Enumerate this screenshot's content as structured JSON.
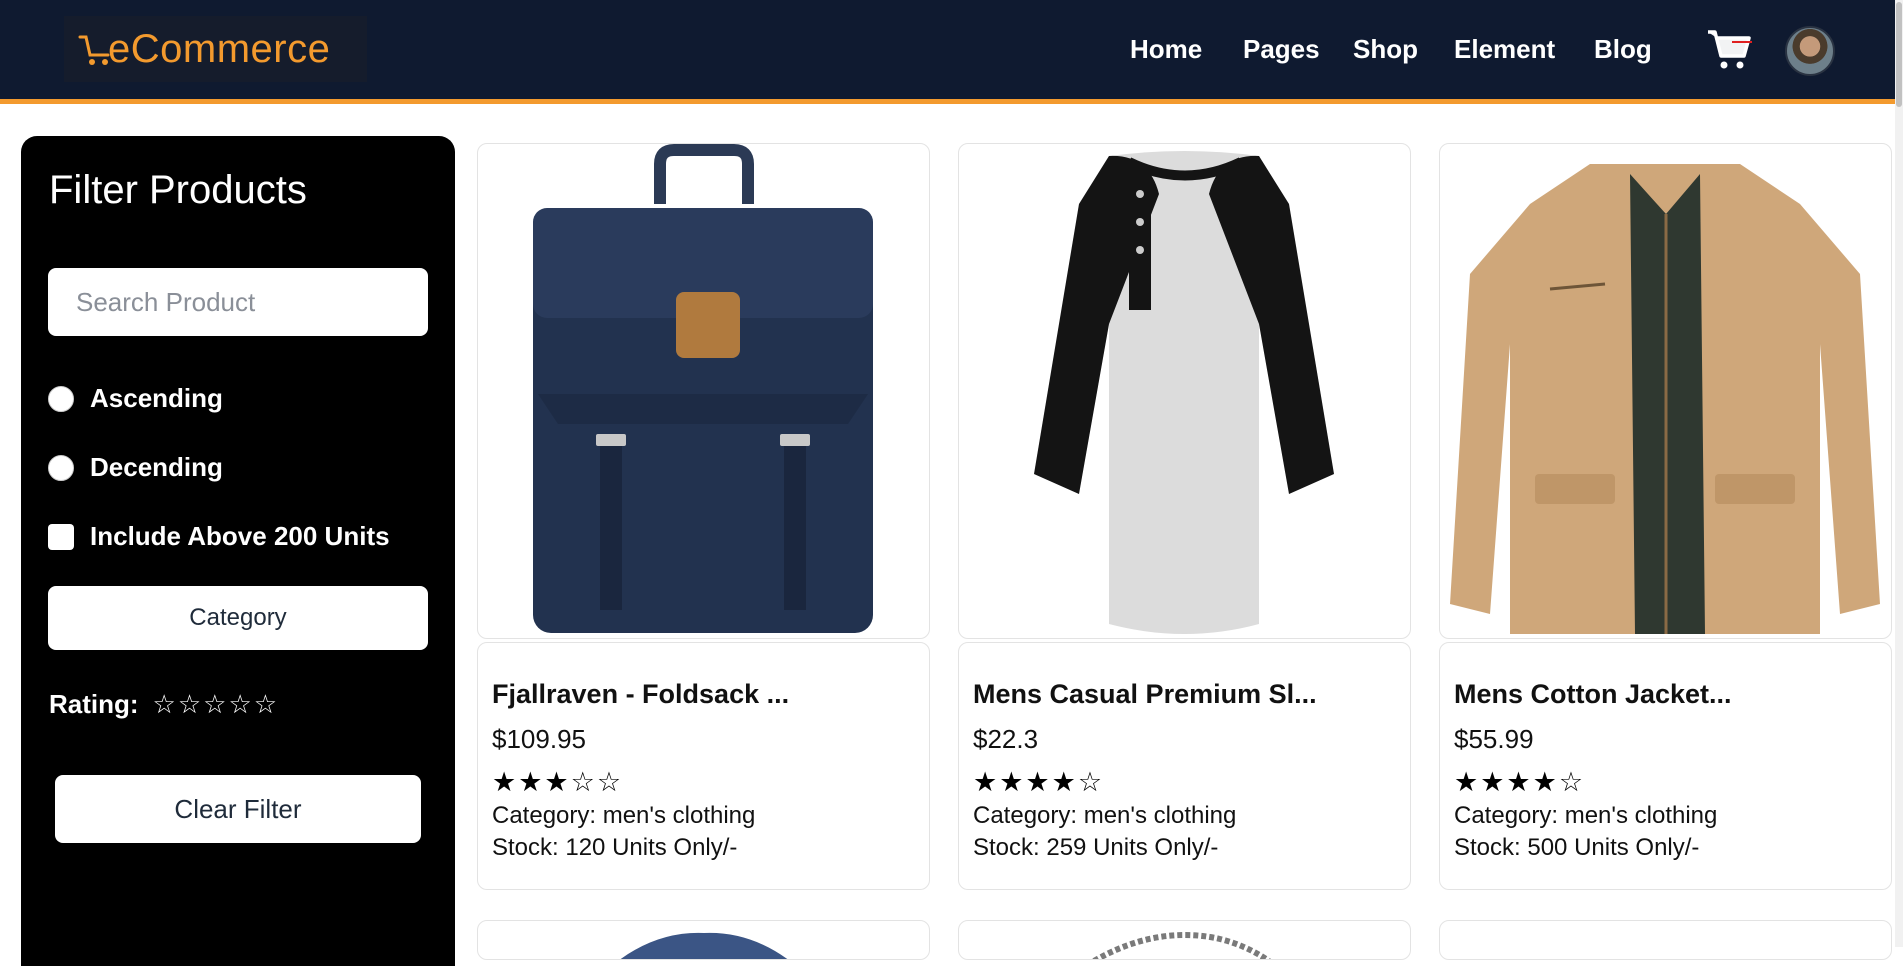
{
  "header": {
    "logo_text": "eCommerce",
    "nav": [
      "Home",
      "Pages",
      "Shop",
      "Element",
      "Blog"
    ],
    "accent_color": "#f39a2e",
    "background": "#0f1a30"
  },
  "sidebar": {
    "title": "Filter Products",
    "search_placeholder": "Search Product",
    "sort_ascending": "Ascending",
    "sort_descending": "Decending",
    "include_above": "Include Above 200 Units",
    "category_button": "Category",
    "rating_label": "Rating:",
    "rating_stars": "☆☆☆☆☆",
    "clear_button": "Clear Filter"
  },
  "products": [
    {
      "title": "Fjallraven - Foldsack ...",
      "price": "$109.95",
      "stars": "★★★☆☆",
      "category": "Category: men's clothing",
      "stock": "Stock: 120 Units Only/-"
    },
    {
      "title": "Mens Casual Premium Sl...",
      "price": "$22.3",
      "stars": "★★★★☆",
      "category": "Category: men's clothing",
      "stock": "Stock: 259 Units Only/-"
    },
    {
      "title": "Mens Cotton Jacket...",
      "price": "$55.99",
      "stars": "★★★★☆",
      "category": "Category: men's clothing",
      "stock": "Stock: 500 Units Only/-"
    }
  ]
}
